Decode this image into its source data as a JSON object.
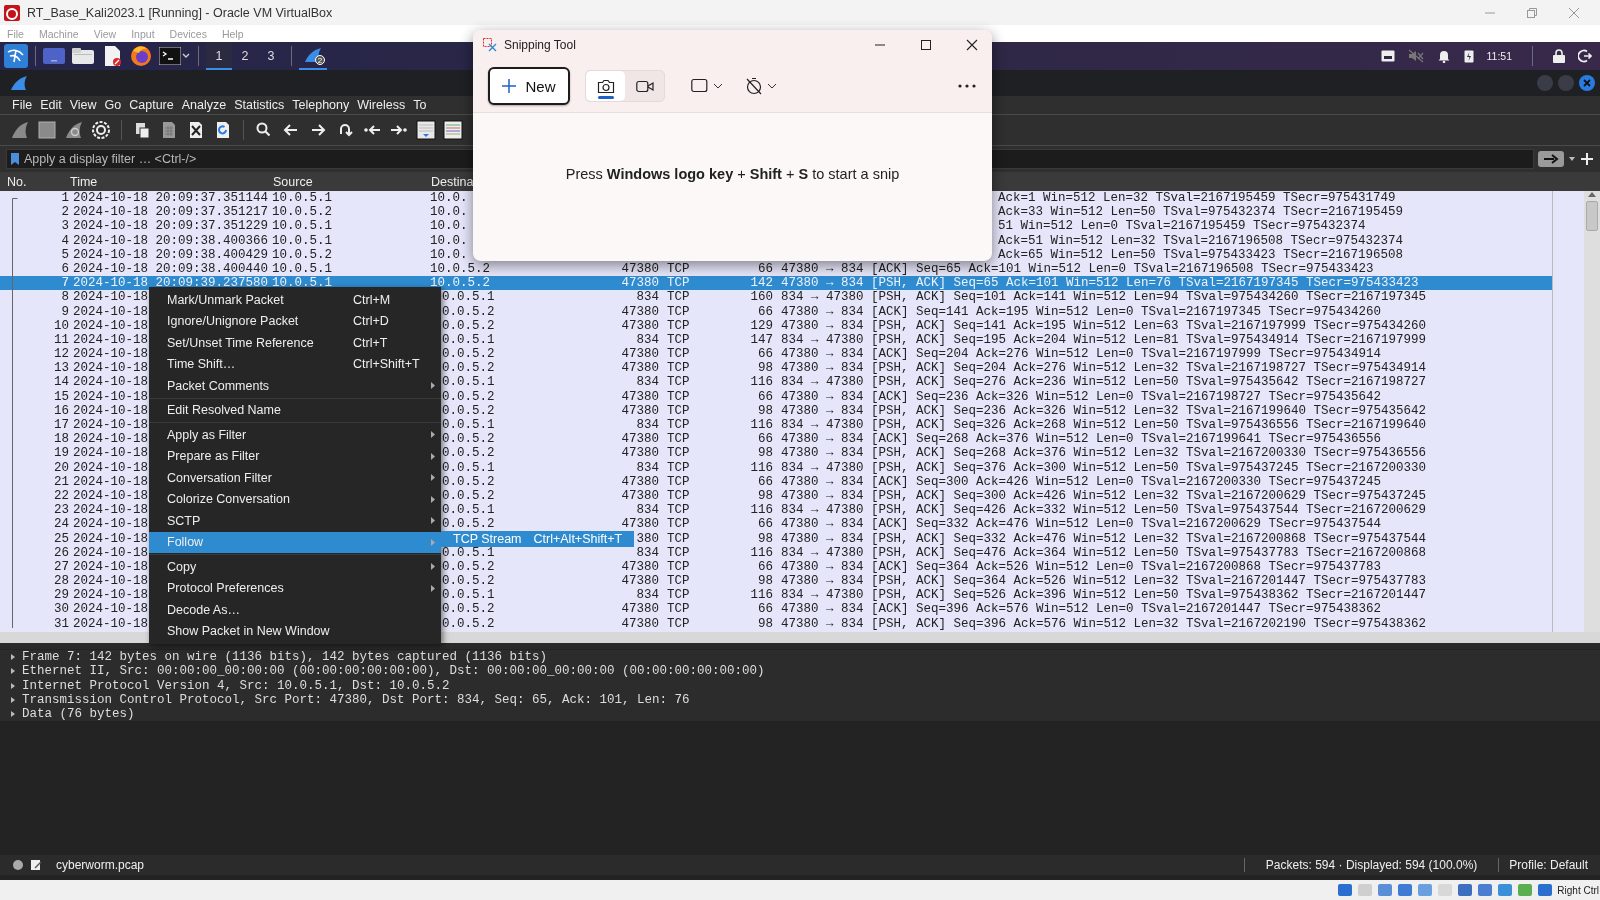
{
  "virtualbox": {
    "title": "RT_Base_Kali2023.1 [Running] - Oracle VM VirtualBox",
    "menu": [
      "File",
      "Machine",
      "View",
      "Input",
      "Devices",
      "Help"
    ],
    "host_key": "Right Ctrl"
  },
  "panel": {
    "workspaces": [
      {
        "label": "1",
        "selected": true
      },
      {
        "label": "2",
        "selected": false
      },
      {
        "label": "3",
        "selected": false
      }
    ],
    "window_count": "2",
    "clock": "11:51"
  },
  "wireshark": {
    "menu": [
      "File",
      "Edit",
      "View",
      "Go",
      "Capture",
      "Analyze",
      "Statistics",
      "Telephony",
      "Wireless",
      "To"
    ],
    "filter": {
      "placeholder": "Apply a display filter … <Ctrl-/>"
    },
    "columns": [
      "No.",
      "Time",
      "Source",
      "Destina"
    ],
    "packets": [
      {
        "kind": "window",
        "selected": false,
        "no": "1",
        "time": "2024-10-18 20:09:37.351144",
        "source": "10.0.5.1",
        "destination": "10.0.",
        "info": "Ack=1 Win=512 Len=32 TSval=2167195459 TSecr=975431749"
      },
      {
        "kind": "window",
        "selected": false,
        "no": "2",
        "time": "2024-10-18 20:09:37.351217",
        "source": "10.0.5.2",
        "destination": "10.0.",
        "info": "Ack=33 Win=512 Len=50 TSval=975432374 TSecr=2167195459"
      },
      {
        "kind": "window",
        "selected": false,
        "no": "3",
        "time": "2024-10-18 20:09:37.351229",
        "source": "10.0.5.1",
        "destination": "10.0.",
        "info": "51 Win=512 Len=0 TSval=2167195459 TSecr=975432374"
      },
      {
        "kind": "window",
        "selected": false,
        "no": "4",
        "time": "2024-10-18 20:09:38.400366",
        "source": "10.0.5.1",
        "destination": "10.0.",
        "info": "Ack=51 Win=512 Len=32 TSval=2167196508 TSecr=975432374"
      },
      {
        "kind": "window",
        "selected": false,
        "no": "5",
        "time": "2024-10-18 20:09:38.400429",
        "source": "10.0.5.2",
        "destination": "10.0.",
        "info": "Ack=65 Win=512 Len=50 TSval=975433423 TSecr=2167196508"
      },
      {
        "kind": "full",
        "selected": false,
        "no": "6",
        "time": "2024-10-18 20:09:38.400440",
        "source": "10.0.5.1",
        "destination": "10.0.5.2",
        "port": "47380",
        "protocol": "TCP",
        "length": "66",
        "info": "47380 → 834 [ACK] Seq=65 Ack=101 Win=512 Len=0 TSval=2167196508 TSecr=975433423"
      },
      {
        "kind": "full",
        "selected": true,
        "no": "7",
        "time": "2024-10-18 20:09:39.237580",
        "source": "10.0.5.1",
        "destination": "10.0.5.2",
        "port": "47380",
        "protocol": "TCP",
        "length": "142",
        "info": "47380 → 834 [PSH, ACK] Seq=65 Ack=101 Win=512 Len=76 TSval=2167197345 TSecr=975433423"
      },
      {
        "kind": "menu",
        "selected": false,
        "no": "8",
        "time": "2024-10-18",
        "destination": "0.0.5.1",
        "port": "834",
        "protocol": "TCP",
        "length": "160",
        "info": "834 → 47380 [PSH, ACK] Seq=101 Ack=141 Win=512 Len=94 TSval=975434260 TSecr=2167197345"
      },
      {
        "kind": "menu",
        "selected": false,
        "no": "9",
        "time": "2024-10-18",
        "destination": "0.0.5.2",
        "port": "47380",
        "protocol": "TCP",
        "length": "66",
        "info": "47380 → 834 [ACK] Seq=141 Ack=195 Win=512 Len=0 TSval=2167197345 TSecr=975434260"
      },
      {
        "kind": "menu",
        "selected": false,
        "no": "10",
        "time": "2024-10-18",
        "destination": "0.0.5.2",
        "port": "47380",
        "protocol": "TCP",
        "length": "129",
        "info": "47380 → 834 [PSH, ACK] Seq=141 Ack=195 Win=512 Len=63 TSval=2167197999 TSecr=975434260"
      },
      {
        "kind": "menu",
        "selected": false,
        "no": "11",
        "time": "2024-10-18",
        "destination": "0.0.5.1",
        "port": "834",
        "protocol": "TCP",
        "length": "147",
        "info": "834 → 47380 [PSH, ACK] Seq=195 Ack=204 Win=512 Len=81 TSval=975434914 TSecr=2167197999"
      },
      {
        "kind": "menu",
        "selected": false,
        "no": "12",
        "time": "2024-10-18",
        "destination": "0.0.5.2",
        "port": "47380",
        "protocol": "TCP",
        "length": "66",
        "info": "47380 → 834 [ACK] Seq=204 Ack=276 Win=512 Len=0 TSval=2167197999 TSecr=975434914"
      },
      {
        "kind": "menu",
        "selected": false,
        "no": "13",
        "time": "2024-10-18",
        "destination": "0.0.5.2",
        "port": "47380",
        "protocol": "TCP",
        "length": "98",
        "info": "47380 → 834 [PSH, ACK] Seq=204 Ack=276 Win=512 Len=32 TSval=2167198727 TSecr=975434914"
      },
      {
        "kind": "menu",
        "selected": false,
        "no": "14",
        "time": "2024-10-18",
        "destination": "0.0.5.1",
        "port": "834",
        "protocol": "TCP",
        "length": "116",
        "info": "834 → 47380 [PSH, ACK] Seq=276 Ack=236 Win=512 Len=50 TSval=975435642 TSecr=2167198727"
      },
      {
        "kind": "menu",
        "selected": false,
        "no": "15",
        "time": "2024-10-18",
        "destination": "0.0.5.2",
        "port": "47380",
        "protocol": "TCP",
        "length": "66",
        "info": "47380 → 834 [ACK] Seq=236 Ack=326 Win=512 Len=0 TSval=2167198727 TSecr=975435642"
      },
      {
        "kind": "menu",
        "selected": false,
        "no": "16",
        "time": "2024-10-18",
        "destination": "0.0.5.2",
        "port": "47380",
        "protocol": "TCP",
        "length": "98",
        "info": "47380 → 834 [PSH, ACK] Seq=236 Ack=326 Win=512 Len=32 TSval=2167199640 TSecr=975435642"
      },
      {
        "kind": "menu",
        "selected": false,
        "no": "17",
        "time": "2024-10-18",
        "destination": "0.0.5.1",
        "port": "834",
        "protocol": "TCP",
        "length": "116",
        "info": "834 → 47380 [PSH, ACK] Seq=326 Ack=268 Win=512 Len=50 TSval=975436556 TSecr=2167199640"
      },
      {
        "kind": "menu",
        "selected": false,
        "no": "18",
        "time": "2024-10-18",
        "destination": "0.0.5.2",
        "port": "47380",
        "protocol": "TCP",
        "length": "66",
        "info": "47380 → 834 [ACK] Seq=268 Ack=376 Win=512 Len=0 TSval=2167199641 TSecr=975436556"
      },
      {
        "kind": "menu",
        "selected": false,
        "no": "19",
        "time": "2024-10-18",
        "destination": "0.0.5.2",
        "port": "47380",
        "protocol": "TCP",
        "length": "98",
        "info": "47380 → 834 [PSH, ACK] Seq=268 Ack=376 Win=512 Len=32 TSval=2167200330 TSecr=975436556"
      },
      {
        "kind": "menu",
        "selected": false,
        "no": "20",
        "time": "2024-10-18",
        "destination": "0.0.5.1",
        "port": "834",
        "protocol": "TCP",
        "length": "116",
        "info": "834 → 47380 [PSH, ACK] Seq=376 Ack=300 Win=512 Len=50 TSval=975437245 TSecr=2167200330"
      },
      {
        "kind": "menu",
        "selected": false,
        "no": "21",
        "time": "2024-10-18",
        "destination": "0.0.5.2",
        "port": "47380",
        "protocol": "TCP",
        "length": "66",
        "info": "47380 → 834 [ACK] Seq=300 Ack=426 Win=512 Len=0 TSval=2167200330 TSecr=975437245"
      },
      {
        "kind": "menu",
        "selected": false,
        "no": "22",
        "time": "2024-10-18",
        "destination": "0.0.5.2",
        "port": "47380",
        "protocol": "TCP",
        "length": "98",
        "info": "47380 → 834 [PSH, ACK] Seq=300 Ack=426 Win=512 Len=32 TSval=2167200629 TSecr=975437245"
      },
      {
        "kind": "menu",
        "selected": false,
        "no": "23",
        "time": "2024-10-18",
        "destination": "0.0.5.1",
        "port": "834",
        "protocol": "TCP",
        "length": "116",
        "info": "834 → 47380 [PSH, ACK] Seq=426 Ack=332 Win=512 Len=50 TSval=975437544 TSecr=2167200629"
      },
      {
        "kind": "menu",
        "selected": false,
        "no": "24",
        "time": "2024-10-18",
        "destination": "0.0.5.2",
        "port": "47380",
        "protocol": "TCP",
        "length": "66",
        "info": "47380 → 834 [ACK] Seq=332 Ack=476 Win=512 Len=0 TSval=2167200629 TSecr=975437544"
      },
      {
        "kind": "menu",
        "selected": false,
        "no": "25",
        "time": "2024-10-18",
        "port": "380",
        "protocol": "TCP",
        "length": "98",
        "info": "47380 → 834 [PSH, ACK] Seq=332 Ack=476 Win=512 Len=32 TSval=2167200868 TSecr=975437544"
      },
      {
        "kind": "menu",
        "selected": false,
        "no": "26",
        "time": "2024-10-18",
        "destination": "0.0.5.1",
        "port": "834",
        "protocol": "TCP",
        "length": "116",
        "info": "834 → 47380 [PSH, ACK] Seq=476 Ack=364 Win=512 Len=50 TSval=975437783 TSecr=2167200868"
      },
      {
        "kind": "menu",
        "selected": false,
        "no": "27",
        "time": "2024-10-18",
        "destination": "0.0.5.2",
        "port": "47380",
        "protocol": "TCP",
        "length": "66",
        "info": "47380 → 834 [ACK] Seq=364 Ack=526 Win=512 Len=0 TSval=2167200868 TSecr=975437783"
      },
      {
        "kind": "menu",
        "selected": false,
        "no": "28",
        "time": "2024-10-18",
        "destination": "0.0.5.2",
        "port": "47380",
        "protocol": "TCP",
        "length": "98",
        "info": "47380 → 834 [PSH, ACK] Seq=364 Ack=526 Win=512 Len=32 TSval=2167201447 TSecr=975437783"
      },
      {
        "kind": "menu",
        "selected": false,
        "no": "29",
        "time": "2024-10-18",
        "destination": "0.0.5.1",
        "port": "834",
        "protocol": "TCP",
        "length": "116",
        "info": "834 → 47380 [PSH, ACK] Seq=526 Ack=396 Win=512 Len=50 TSval=975438362 TSecr=2167201447"
      },
      {
        "kind": "menu",
        "selected": false,
        "no": "30",
        "time": "2024-10-18",
        "destination": "0.0.5.2",
        "port": "47380",
        "protocol": "TCP",
        "length": "66",
        "info": "47380 → 834 [ACK] Seq=396 Ack=576 Win=512 Len=0 TSval=2167201447 TSecr=975438362"
      },
      {
        "kind": "menu",
        "selected": false,
        "no": "31",
        "time": "2024-10-18",
        "destination": "0.0.5.2",
        "port": "47380",
        "protocol": "TCP",
        "length": "98",
        "info": "47380 → 834 [PSH, ACK] Seq=396 Ack=576 Win=512 Len=32 TSval=2167202190 TSecr=975438362"
      }
    ],
    "details": [
      {
        "text": "Frame 7: 142 bytes on wire (1136 bits), 142 bytes captured (1136 bits)",
        "expanded": false
      },
      {
        "text": "Ethernet II, Src: 00:00:00_00:00:00 (00:00:00:00:00:00), Dst: 00:00:00_00:00:00 (00:00:00:00:00:00)",
        "expanded": false
      },
      {
        "text": "Internet Protocol Version 4, Src: 10.0.5.1, Dst: 10.0.5.2",
        "expanded": false
      },
      {
        "text": "Transmission Control Protocol, Src Port: 47380, Dst Port: 834, Seq: 65, Ack: 101, Len: 76",
        "expanded": false
      },
      {
        "text": "Data (76 bytes)",
        "expanded": false
      }
    ],
    "status_bar": {
      "file": "cyberworm.pcap",
      "counts": "Packets: 594 · Displayed: 594 (100.0%)",
      "profile": "Profile: Default"
    }
  },
  "context_menu": {
    "groups": [
      [
        {
          "label": "Mark/Unmark Packet",
          "shortcut": "Ctrl+M",
          "has_submenu": false,
          "selected": false
        },
        {
          "label": "Ignore/Unignore Packet",
          "shortcut": "Ctrl+D",
          "has_submenu": false,
          "selected": false
        },
        {
          "label": "Set/Unset Time Reference",
          "shortcut": "Ctrl+T",
          "has_submenu": false,
          "selected": false
        },
        {
          "label": "Time Shift…",
          "shortcut": "Ctrl+Shift+T",
          "has_submenu": false,
          "selected": false
        },
        {
          "label": "Packet Comments",
          "has_submenu": true,
          "selected": false
        }
      ],
      [
        {
          "label": "Edit Resolved Name",
          "has_submenu": false,
          "selected": false
        }
      ],
      [
        {
          "label": "Apply as Filter",
          "has_submenu": true,
          "selected": false
        },
        {
          "label": "Prepare as Filter",
          "has_submenu": true,
          "selected": false
        },
        {
          "label": "Conversation Filter",
          "has_submenu": true,
          "selected": false
        },
        {
          "label": "Colorize Conversation",
          "has_submenu": true,
          "selected": false
        },
        {
          "label": "SCTP",
          "has_submenu": true,
          "selected": false
        },
        {
          "label": "Follow",
          "has_submenu": true,
          "selected": true
        }
      ],
      [
        {
          "label": "Copy",
          "has_submenu": true,
          "selected": false
        },
        {
          "label": "Protocol Preferences",
          "has_submenu": true,
          "selected": false
        },
        {
          "label": "Decode As…",
          "has_submenu": false,
          "selected": false
        },
        {
          "label": "Show Packet in New Window",
          "has_submenu": false,
          "selected": false
        }
      ]
    ],
    "submenu": {
      "label": "TCP Stream",
      "shortcut": "Ctrl+Alt+Shift+T"
    }
  },
  "snipping_tool": {
    "title": "Snipping Tool",
    "new_button": "New",
    "modes": [
      {
        "kind": "photo",
        "selected": true
      },
      {
        "kind": "video",
        "selected": false
      }
    ],
    "hint": "Press **Windows logo key** + **Shift** + **S** to start a snip"
  }
}
